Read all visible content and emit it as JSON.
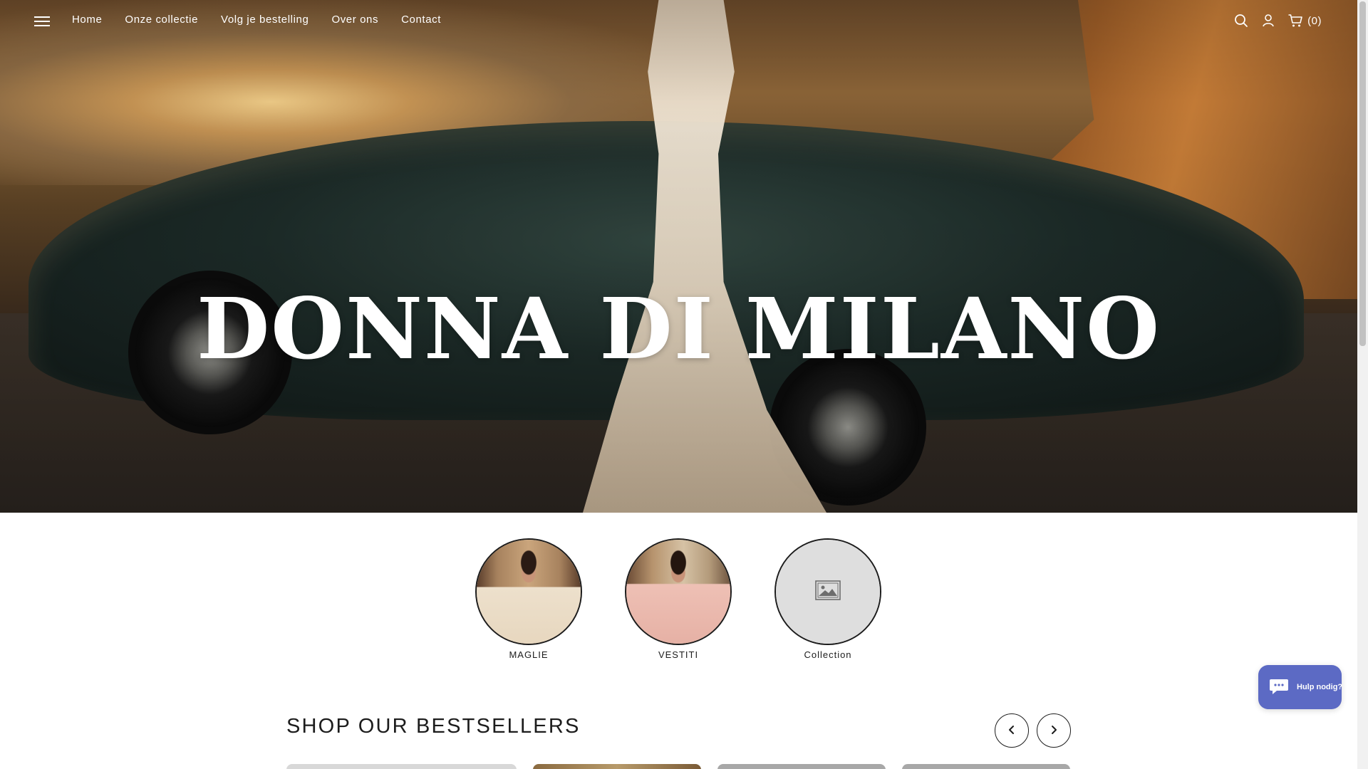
{
  "header": {
    "menu_icon": "hamburger-icon",
    "nav": [
      "Home",
      "Onze collectie",
      "Volg je bestelling",
      "Over ons",
      "Contact"
    ],
    "icons": [
      "search-icon",
      "account-icon",
      "cart-icon"
    ],
    "cart_count": "(0)"
  },
  "hero": {
    "title": "DONNA DI MILANO"
  },
  "collections": [
    {
      "label": "MAGLIE",
      "image": "photo"
    },
    {
      "label": "VESTITI",
      "image": "photo"
    },
    {
      "label": "Collection",
      "image": "image-placeholder-icon"
    }
  ],
  "bestsellers": {
    "title": "SHOP OUR BESTSELLERS",
    "prev_icon": "chevron-left-icon",
    "next_icon": "chevron-right-icon"
  },
  "chat": {
    "label": "Hulp nodig?",
    "icon": "chat-bubble-icon"
  },
  "colors": {
    "text": "#1c1c1c",
    "white": "#ffffff",
    "chat_bg": "#5c6ac4",
    "placeholder_bg": "#dedede"
  }
}
